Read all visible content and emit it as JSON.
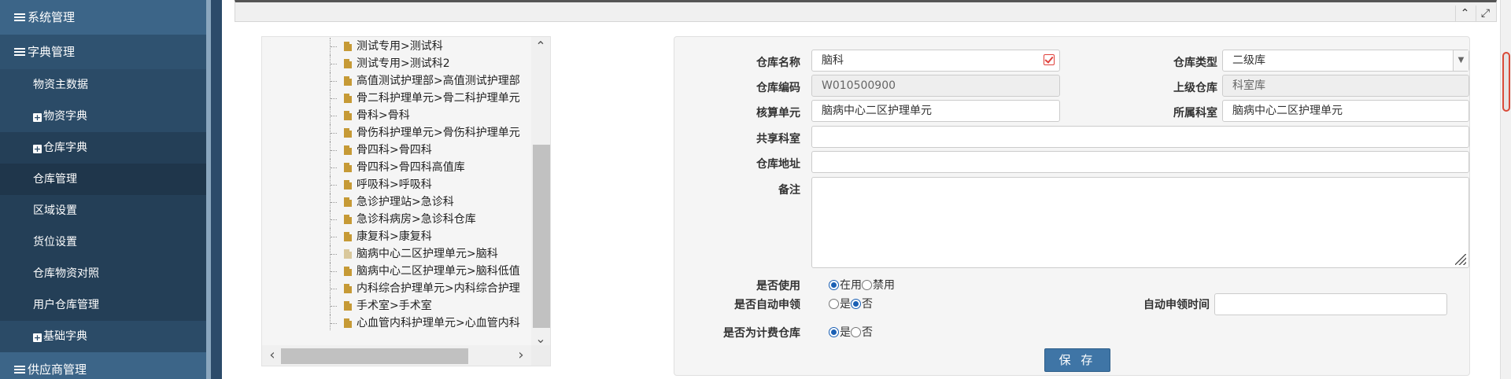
{
  "sidebar": {
    "items": [
      {
        "label": "系统管理"
      },
      {
        "label": "字典管理"
      },
      {
        "label": "物资主数据"
      },
      {
        "label": "物资字典"
      },
      {
        "label": "仓库字典"
      },
      {
        "label": "仓库管理"
      },
      {
        "label": "区域设置"
      },
      {
        "label": "货位设置"
      },
      {
        "label": "仓库物资对照"
      },
      {
        "label": "用户仓库管理"
      },
      {
        "label": "基础字典"
      },
      {
        "label": "供应商管理"
      }
    ]
  },
  "header": {
    "collapse_icon": "chevron-up-icon",
    "expand_icon": "fullscreen-icon"
  },
  "tree": {
    "items": [
      {
        "label": "测试专用>测试科"
      },
      {
        "label": "测试专用>测试科2"
      },
      {
        "label": "高值测试护理部>高值测试护理部"
      },
      {
        "label": "骨二科护理单元>骨二科护理单元"
      },
      {
        "label": "骨科>骨科"
      },
      {
        "label": "骨伤科护理单元>骨伤科护理单元"
      },
      {
        "label": "骨四科>骨四科"
      },
      {
        "label": "骨四科>骨四科高值库"
      },
      {
        "label": "呼吸科>呼吸科"
      },
      {
        "label": "急诊护理站>急诊科"
      },
      {
        "label": "急诊科病房>急诊科仓库"
      },
      {
        "label": "康复科>康复科"
      },
      {
        "label": "脑病中心二区护理单元>脑科"
      },
      {
        "label": "脑病中心二区护理单元>脑科低值"
      },
      {
        "label": "内科综合护理单元>内科综合护理"
      },
      {
        "label": "手术室>手术室"
      },
      {
        "label": "心血管内科护理单元>心血管内科"
      }
    ],
    "selected_index": 12
  },
  "form": {
    "warehouse_name_label": "仓库名称",
    "warehouse_name_value": "脑科",
    "warehouse_type_label": "仓库类型",
    "warehouse_type_value": "二级库",
    "warehouse_code_label": "仓库编码",
    "warehouse_code_value": "W010500900",
    "parent_warehouse_label": "上级仓库",
    "parent_warehouse_value": "科室库",
    "accounting_unit_label": "核算单元",
    "accounting_unit_value": "脑病中心二区护理单元",
    "department_label": "所属科室",
    "department_value": "脑病中心二区护理单元",
    "shared_dept_label": "共享科室",
    "shared_dept_value": "",
    "address_label": "仓库地址",
    "address_value": "",
    "remark_label": "备注",
    "remark_value": "",
    "in_use_label": "是否使用",
    "in_use_options": [
      "在用",
      "禁用"
    ],
    "auto_apply_label": "是否自动申领",
    "auto_apply_options": [
      "是",
      "否"
    ],
    "auto_apply_time_label": "自动申领时间",
    "auto_apply_time_value": "",
    "billing_label": "是否为计费仓库",
    "billing_options": [
      "是",
      "否"
    ],
    "save_label": "保 存"
  }
}
